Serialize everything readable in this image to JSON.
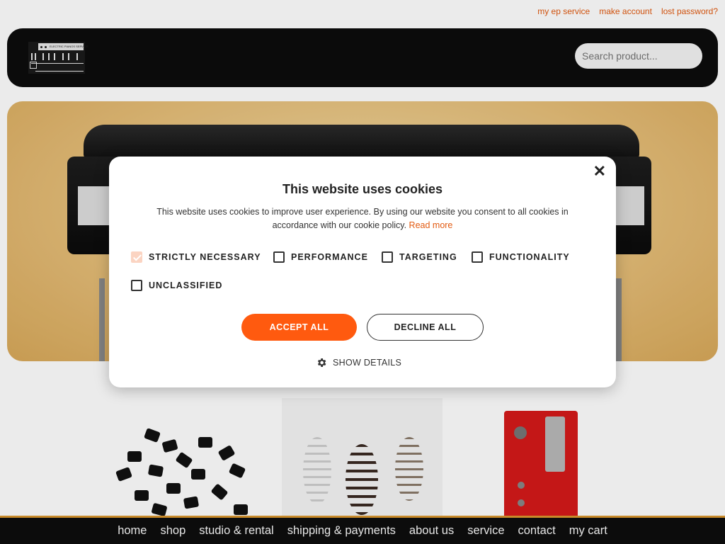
{
  "top_links": [
    "my ep service",
    "make account",
    "lost password?"
  ],
  "header": {
    "logo_text": "ELECTRIC PIANOS SERVICE",
    "search_placeholder": "Search product..."
  },
  "cookie": {
    "title": "This website uses cookies",
    "description": "This website uses cookies to improve user experience. By using our website you consent to all cookies in accordance with our cookie policy.",
    "read_more": "Read more",
    "close_icon": "close-icon",
    "categories": [
      {
        "label": "STRICTLY NECESSARY",
        "checked": true
      },
      {
        "label": "PERFORMANCE",
        "checked": false
      },
      {
        "label": "TARGETING",
        "checked": false
      },
      {
        "label": "FUNCTIONALITY",
        "checked": false
      },
      {
        "label": "UNCLASSIFIED",
        "checked": false
      }
    ],
    "accept_label": "ACCEPT ALL",
    "decline_label": "DECLINE ALL",
    "details_label": "SHOW DETAILS",
    "details_icon": "gear-icon",
    "accent_color": "#ff5a0f"
  },
  "nav": [
    "home",
    "shop",
    "studio & rental",
    "shipping & payments",
    "about us",
    "service",
    "contact",
    "my cart"
  ],
  "colors": {
    "link": "#e25a10",
    "header_bg": "#0d0d0d",
    "nav_border": "#c88a2a"
  }
}
